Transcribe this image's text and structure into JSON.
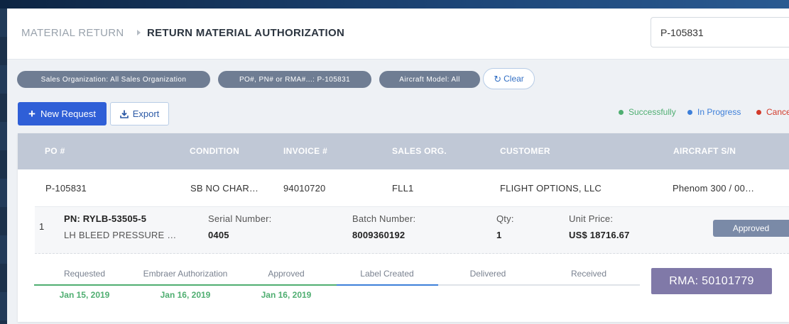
{
  "breadcrumb": {
    "root": "MATERIAL RETURN",
    "current": "RETURN MATERIAL AUTHORIZATION"
  },
  "search": {
    "value": "P-105831"
  },
  "filters": [
    {
      "label": "Sales Organization: All Sales Organization"
    },
    {
      "label": "PO#, PN# or RMA#...: P-105831"
    },
    {
      "label": "Aircraft Model: All"
    }
  ],
  "clear_label": "Clear",
  "actions": {
    "new_request": "New Request",
    "export": "Export"
  },
  "legend": [
    {
      "label": "Successfully",
      "color": "#4fae71"
    },
    {
      "label": "In Progress",
      "color": "#3d7fd9"
    },
    {
      "label": "Cance",
      "color": "#d23a2a"
    }
  ],
  "columns": {
    "po": "PO #",
    "condition": "CONDITION",
    "invoice": "INVOICE #",
    "sales_org": "SALES ORG.",
    "customer": "CUSTOMER",
    "aircraft_sn": "AIRCRAFT S/N"
  },
  "order": {
    "po": "P-105831",
    "condition": "SB NO CHAR…",
    "invoice": "94010720",
    "sales_org": "FLL1",
    "customer": "FLIGHT OPTIONS, LLC",
    "aircraft_sn": "Phenom 300 / 00…"
  },
  "item": {
    "index": "1",
    "pn": "PN: RYLB-53505-5",
    "description": "LH BLEED PRESSURE …",
    "serial_label": "Serial Number:",
    "serial_value": "0405",
    "batch_label": "Batch Number:",
    "batch_value": "8009360192",
    "qty_label": "Qty:",
    "qty_value": "1",
    "price_label": "Unit Price:",
    "price_value": "US$ 18716.67",
    "status": "Approved"
  },
  "progress": {
    "steps": [
      {
        "label": "Requested",
        "date": "Jan 15, 2019"
      },
      {
        "label": "Embraer Authorization",
        "date": "Jan 16, 2019"
      },
      {
        "label": "Approved",
        "date": "Jan 16, 2019"
      },
      {
        "label": "Label Created",
        "date": ""
      },
      {
        "label": "Delivered",
        "date": ""
      },
      {
        "label": "Received",
        "date": ""
      }
    ],
    "completed_steps": 3,
    "active_step": 4
  },
  "rma": "RMA: 50101779",
  "icons": {
    "separator": "caret-right-icon",
    "clear": "refresh-icon",
    "new": "plus-icon",
    "export": "download-icon"
  }
}
